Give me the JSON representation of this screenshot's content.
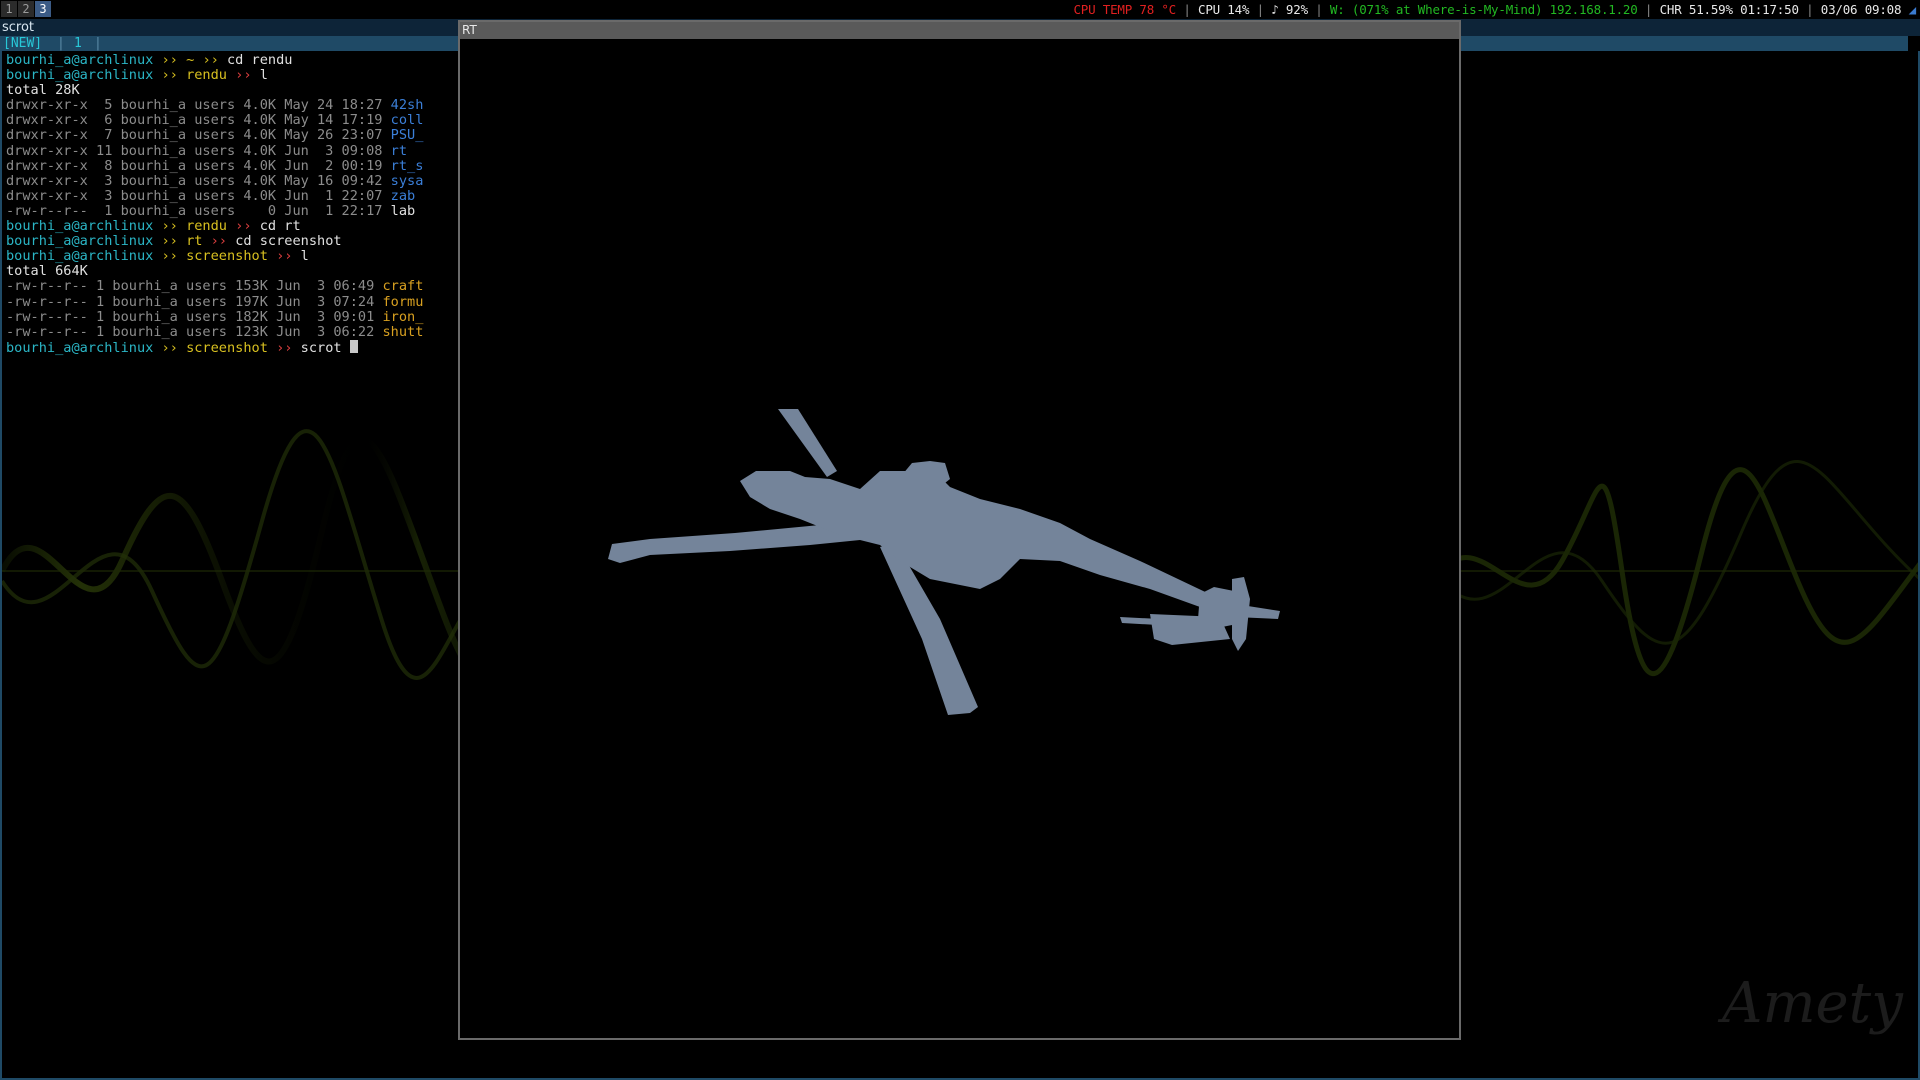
{
  "workspaces": [
    {
      "label": "1",
      "active": false
    },
    {
      "label": "2",
      "active": false
    },
    {
      "label": "3",
      "active": true
    }
  ],
  "status": {
    "cpu_temp": "CPU TEMP 78 °C",
    "cpu": "CPU 14%",
    "volume": "♪ 92%",
    "wifi_prefix": "W: (071% at Where-is-My-Mind)",
    "ip": "192.168.1.20",
    "battery": "CHR 51.59% 01:17:50",
    "datetime": "03/06 09:08",
    "tray_icon_color": "#3b7bd0"
  },
  "terminal": {
    "title": "scrot",
    "tab_new": "[NEW]",
    "tab_number": "1",
    "lines": [
      [
        {
          "t": "bourhi_a@archlinux ",
          "c": "cyan"
        },
        {
          "t": "›› ",
          "c": "yellow"
        },
        {
          "t": "~ ",
          "c": "yellow"
        },
        {
          "t": "›› ",
          "c": "yellow"
        },
        {
          "t": "cd rendu",
          "c": "white"
        }
      ],
      [
        {
          "t": "bourhi_a@archlinux ",
          "c": "cyan"
        },
        {
          "t": "›› ",
          "c": "yellow"
        },
        {
          "t": "rendu ",
          "c": "yellow"
        },
        {
          "t": "›› ",
          "c": "red"
        },
        {
          "t": "l",
          "c": "white"
        }
      ],
      [
        {
          "t": "total 28K",
          "c": "white"
        }
      ],
      [
        {
          "t": "drwxr-xr-x  5 bourhi_a users 4.0K May 24 18:27 ",
          "c": "gray"
        },
        {
          "t": "42sh",
          "c": "blue"
        }
      ],
      [
        {
          "t": "drwxr-xr-x  6 bourhi_a users 4.0K May 14 17:19 ",
          "c": "gray"
        },
        {
          "t": "coll",
          "c": "blue"
        }
      ],
      [
        {
          "t": "drwxr-xr-x  7 bourhi_a users 4.0K May 26 23:07 ",
          "c": "gray"
        },
        {
          "t": "PSU_",
          "c": "blue"
        }
      ],
      [
        {
          "t": "drwxr-xr-x 11 bourhi_a users 4.0K Jun  3 09:08 ",
          "c": "gray"
        },
        {
          "t": "rt",
          "c": "blue"
        }
      ],
      [
        {
          "t": "drwxr-xr-x  8 bourhi_a users 4.0K Jun  2 00:19 ",
          "c": "gray"
        },
        {
          "t": "rt_s",
          "c": "blue"
        }
      ],
      [
        {
          "t": "drwxr-xr-x  3 bourhi_a users 4.0K May 16 09:42 ",
          "c": "gray"
        },
        {
          "t": "sysa",
          "c": "blue"
        }
      ],
      [
        {
          "t": "drwxr-xr-x  3 bourhi_a users 4.0K Jun  1 22:07 ",
          "c": "gray"
        },
        {
          "t": "zab",
          "c": "blue"
        }
      ],
      [
        {
          "t": "-rw-r--r--  1 bourhi_a users    0 Jun  1 22:17 ",
          "c": "gray"
        },
        {
          "t": "lab",
          "c": "white"
        }
      ],
      [
        {
          "t": "bourhi_a@archlinux ",
          "c": "cyan"
        },
        {
          "t": "›› ",
          "c": "yellow"
        },
        {
          "t": "rendu ",
          "c": "yellow"
        },
        {
          "t": "›› ",
          "c": "red"
        },
        {
          "t": "cd rt",
          "c": "white"
        }
      ],
      [
        {
          "t": "bourhi_a@archlinux ",
          "c": "cyan"
        },
        {
          "t": "›› ",
          "c": "yellow"
        },
        {
          "t": "rt ",
          "c": "yellow"
        },
        {
          "t": "›› ",
          "c": "red"
        },
        {
          "t": "cd screenshot",
          "c": "white"
        }
      ],
      [
        {
          "t": "bourhi_a@archlinux ",
          "c": "cyan"
        },
        {
          "t": "›› ",
          "c": "yellow"
        },
        {
          "t": "screenshot ",
          "c": "yellow"
        },
        {
          "t": "›› ",
          "c": "red"
        },
        {
          "t": "l",
          "c": "white"
        }
      ],
      [
        {
          "t": "total 664K",
          "c": "white"
        }
      ],
      [
        {
          "t": "-rw-r--r-- 1 bourhi_a users 153K Jun  3 06:49 ",
          "c": "gray"
        },
        {
          "t": "craft",
          "c": "orange"
        }
      ],
      [
        {
          "t": "-rw-r--r-- 1 bourhi_a users 197K Jun  3 07:24 ",
          "c": "gray"
        },
        {
          "t": "formu",
          "c": "orange"
        }
      ],
      [
        {
          "t": "-rw-r--r-- 1 bourhi_a users 182K Jun  3 09:01 ",
          "c": "gray"
        },
        {
          "t": "iron_",
          "c": "orange"
        }
      ],
      [
        {
          "t": "-rw-r--r-- 1 bourhi_a users 123K Jun  3 06:22 ",
          "c": "gray"
        },
        {
          "t": "shutt",
          "c": "orange"
        }
      ],
      [
        {
          "t": "bourhi_a@archlinux ",
          "c": "cyan"
        },
        {
          "t": "›› ",
          "c": "yellow"
        },
        {
          "t": "screenshot ",
          "c": "yellow"
        },
        {
          "t": "›› ",
          "c": "red"
        },
        {
          "t": "scrot ",
          "c": "white"
        }
      ]
    ]
  },
  "rt_window": {
    "title": "RT",
    "model_color": "#74849a"
  },
  "colors": {
    "terminal_border": "#1f4a66",
    "workspace_active": "#3b5b86",
    "wallpaper_wave": "#2a3a08"
  }
}
